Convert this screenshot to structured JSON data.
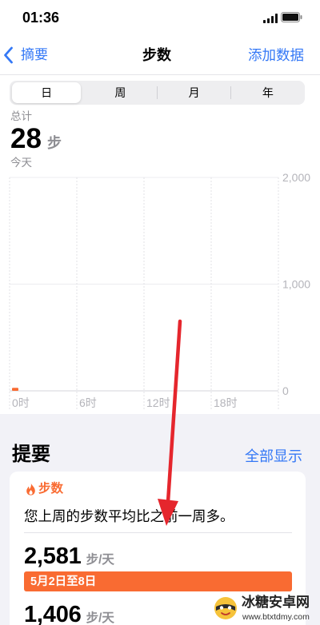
{
  "status_bar": {
    "time": "01:36"
  },
  "nav": {
    "back_label": "摘要",
    "title": "步数",
    "action_label": "添加数据"
  },
  "segments": [
    {
      "label": "日",
      "selected": true
    },
    {
      "label": "周",
      "selected": false
    },
    {
      "label": "月",
      "selected": false
    },
    {
      "label": "年",
      "selected": false
    }
  ],
  "summary_stat": {
    "caption": "总计",
    "value": "28",
    "unit": "步",
    "period": "今天"
  },
  "chart_data": {
    "type": "bar",
    "x_range": [
      0,
      24
    ],
    "ylim": [
      0,
      2000
    ],
    "grid": true,
    "y_ticks": [
      {
        "value": 2000,
        "label": "2,000"
      },
      {
        "value": 1000,
        "label": "1,000"
      },
      {
        "value": 0,
        "label": "0"
      }
    ],
    "x_ticks": [
      {
        "hour": 0,
        "label": "0时"
      },
      {
        "hour": 6,
        "label": "6时"
      },
      {
        "hour": 12,
        "label": "12时"
      },
      {
        "hour": 18,
        "label": "18时"
      }
    ],
    "bars": [
      {
        "hour": 0,
        "value": 28
      }
    ]
  },
  "highlights": {
    "heading": "提要",
    "show_all_label": "全部显示",
    "card": {
      "category": "步数",
      "message": "您上周的步数平均比之前一周多。",
      "rows": [
        {
          "value": "2,581",
          "unit": "步/天",
          "bar_label": "5月2日至8日"
        },
        {
          "value": "1,406",
          "unit": "步/天"
        }
      ]
    }
  },
  "watermark": {
    "name": "冰糖安卓网",
    "url": "www.btxtdmy.com"
  },
  "icons": {
    "back": "chevron-left-icon",
    "card": "flame-icon",
    "signal": "cellular-signal-icon",
    "battery": "battery-icon",
    "annotation": "arrow-down-icon"
  },
  "colors": {
    "accent_blue": "#3478f6",
    "accent_orange": "#f96b32",
    "text_secondary": "#8e8e93",
    "grouped_background": "#f2f2f7",
    "annotation_red": "#e5262d"
  }
}
